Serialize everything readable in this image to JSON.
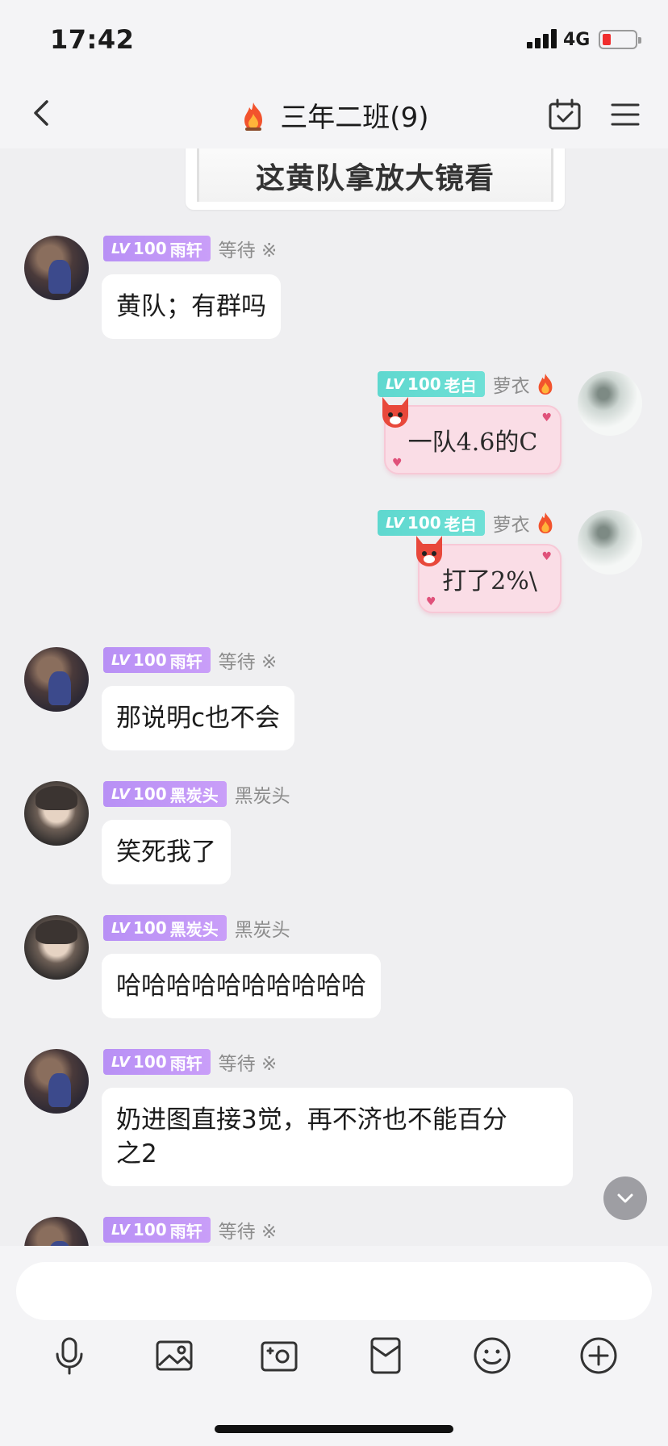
{
  "status_bar": {
    "time": "17:42",
    "network": "4G"
  },
  "header": {
    "title": "三年二班(9)"
  },
  "image_card": {
    "text": "这黄队拿放大镜看"
  },
  "messages": [
    {
      "lv_tag": "LV",
      "lv_num": "100",
      "badge_name": "雨轩",
      "nickname": "等待 ※",
      "text": "黄队；有群吗"
    },
    {
      "lv_tag": "LV",
      "lv_num": "100",
      "badge_name": "老白",
      "nickname": "萝衣",
      "text": "一队4.6的C"
    },
    {
      "lv_tag": "LV",
      "lv_num": "100",
      "badge_name": "老白",
      "nickname": "萝衣",
      "text": "打了2%\\"
    },
    {
      "lv_tag": "LV",
      "lv_num": "100",
      "badge_name": "雨轩",
      "nickname": "等待 ※",
      "text": "那说明c也不会"
    },
    {
      "lv_tag": "LV",
      "lv_num": "100",
      "badge_name": "黑炭头",
      "nickname": "黑炭头",
      "text": "笑死我了"
    },
    {
      "lv_tag": "LV",
      "lv_num": "100",
      "badge_name": "黑炭头",
      "nickname": "黑炭头",
      "text": "哈哈哈哈哈哈哈哈哈哈"
    },
    {
      "lv_tag": "LV",
      "lv_num": "100",
      "badge_name": "雨轩",
      "nickname": "等待 ※",
      "text": "奶进图直接3觉，再不济也不能百分\n之2"
    },
    {
      "lv_tag": "LV",
      "lv_num": "100",
      "badge_name": "雨轩",
      "nickname": "等待 ※"
    }
  ],
  "colors": {
    "purple_badge": "#b890f5",
    "teal_badge": "#5fd8cf",
    "sticker_pink": "#fadde6"
  }
}
